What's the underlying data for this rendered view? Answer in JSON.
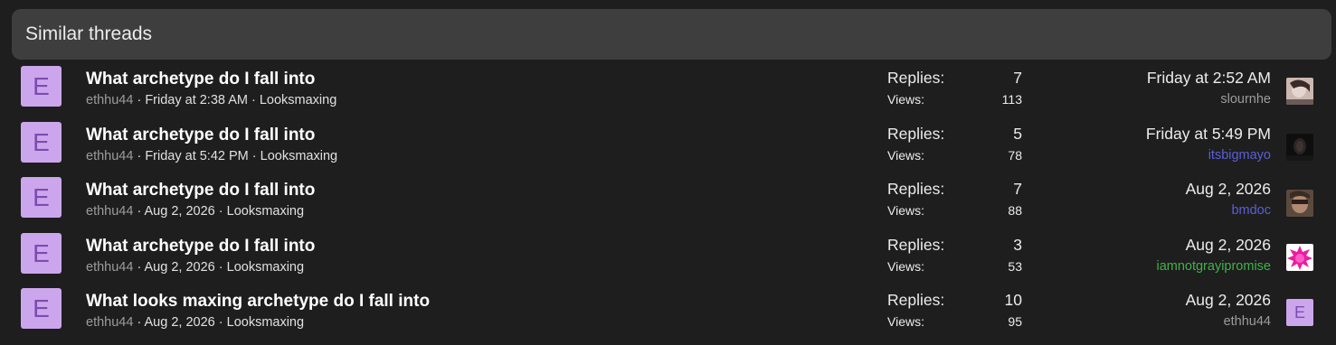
{
  "header": {
    "title": "Similar threads"
  },
  "labels": {
    "replies": "Replies:",
    "views": "Views:"
  },
  "threads": [
    {
      "avatar_letter": "E",
      "title": "What archetype do I fall into",
      "author": "ethhu44",
      "date": "Friday at 2:38 AM",
      "forum": "Looksmaxing",
      "replies": "7",
      "views": "113",
      "last_date": "Friday at 2:52 AM",
      "last_user": "slournhe",
      "last_user_color": "#9c9c9c",
      "last_avatar": "photo-icon"
    },
    {
      "avatar_letter": "E",
      "title": "What archetype do I fall into",
      "author": "ethhu44",
      "date": "Friday at 5:42 PM",
      "forum": "Looksmaxing",
      "replies": "5",
      "views": "78",
      "last_date": "Friday at 5:49 PM",
      "last_user": "itsbigmayo",
      "last_user_color": "#5b5fd6",
      "last_avatar": "photo-icon"
    },
    {
      "avatar_letter": "E",
      "title": "What archetype do I fall into",
      "author": "ethhu44",
      "date": "Aug 2, 2026",
      "forum": "Looksmaxing",
      "replies": "7",
      "views": "88",
      "last_date": "Aug 2, 2026",
      "last_user": "bmdoc",
      "last_user_color": "#5b5fd6",
      "last_avatar": "photo-icon"
    },
    {
      "avatar_letter": "E",
      "title": "What archetype do I fall into",
      "author": "ethhu44",
      "date": "Aug 2, 2026",
      "forum": "Looksmaxing",
      "replies": "3",
      "views": "53",
      "last_date": "Aug 2, 2026",
      "last_user": "iamnotgrayipromise",
      "last_user_color": "#3fb24a",
      "last_avatar": "badge-icon"
    },
    {
      "avatar_letter": "E",
      "title": "What looks maxing archetype do I fall into",
      "author": "ethhu44",
      "date": "Aug 2, 2026",
      "forum": "Looksmaxing",
      "replies": "10",
      "views": "95",
      "last_date": "Aug 2, 2026",
      "last_user": "ethhu44",
      "last_user_color": "#9c9c9c",
      "last_avatar_letter": "E"
    }
  ],
  "separator": " · "
}
